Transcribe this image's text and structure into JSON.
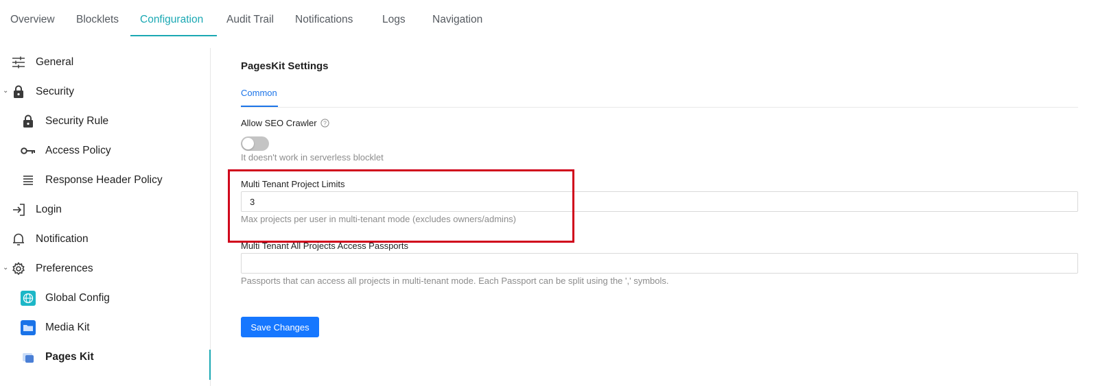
{
  "topnav": {
    "tabs": [
      {
        "label": "Overview"
      },
      {
        "label": "Blocklets"
      },
      {
        "label": "Configuration"
      },
      {
        "label": "Audit Trail"
      },
      {
        "label": "Notifications"
      },
      {
        "label": "Logs"
      },
      {
        "label": "Navigation"
      }
    ],
    "active_index": 2
  },
  "sidebar": {
    "items": [
      {
        "label": "General",
        "icon": "sliders-icon"
      },
      {
        "label": "Security",
        "icon": "lock-icon",
        "expanded": true
      },
      {
        "label": "Security Rule",
        "icon": "lock-icon"
      },
      {
        "label": "Access Policy",
        "icon": "key-icon"
      },
      {
        "label": "Response Header Policy",
        "icon": "list-icon"
      },
      {
        "label": "Login",
        "icon": "login-icon"
      },
      {
        "label": "Notification",
        "icon": "bell-icon"
      },
      {
        "label": "Preferences",
        "icon": "gear-icon",
        "expanded": true
      },
      {
        "label": "Global Config",
        "icon": "global-config-app-icon"
      },
      {
        "label": "Media Kit",
        "icon": "media-kit-app-icon"
      },
      {
        "label": "Pages Kit",
        "icon": "pages-kit-app-icon",
        "active": true
      }
    ]
  },
  "main": {
    "title": "PagesKit Settings",
    "subtab": "Common",
    "seo": {
      "label": "Allow SEO Crawler",
      "help_icon": "question-circle-icon",
      "enabled": false,
      "hint": "It doesn't work in serverless blocklet"
    },
    "project_limits": {
      "label": "Multi Tenant Project Limits",
      "value": "3",
      "hint": "Max projects per user in multi-tenant mode (excludes owners/admins)"
    },
    "passports": {
      "label": "Multi Tenant All Projects Access Passports",
      "value": "",
      "hint": "Passports that can access all projects in multi-tenant mode. Each Passport can be split using the ',' symbols."
    },
    "save_label": "Save Changes"
  },
  "colors": {
    "accent_teal": "#1aa8b3",
    "primary_blue": "#1677ff",
    "highlight_red": "#d0021b"
  }
}
